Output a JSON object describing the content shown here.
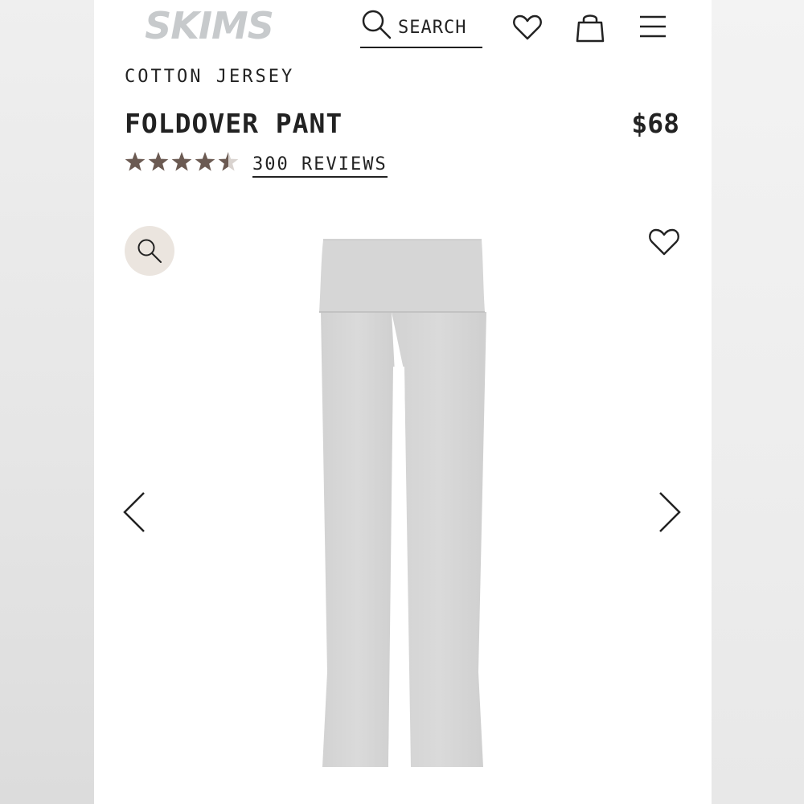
{
  "header": {
    "logo_text": "SKIMS",
    "search_label": "SEARCH",
    "icons": {
      "search": "search-icon",
      "wishlist": "heart-icon",
      "bag": "shopping-bag-icon",
      "menu": "hamburger-menu-icon"
    }
  },
  "product": {
    "category": "COTTON JERSEY",
    "title": "FOLDOVER PANT",
    "price": "$68",
    "rating": 4.5,
    "rating_max": 5,
    "reviews_label": "300 REVIEWS"
  },
  "gallery": {
    "icons": {
      "zoom": "magnifier-icon",
      "save": "heart-icon",
      "prev": "chevron-left-icon",
      "next": "chevron-right-icon"
    }
  },
  "colors": {
    "text": "#222222",
    "logo": "#c7cacc",
    "star": "#6b5a52",
    "zoom_bg": "#ebe5df",
    "product_gray": "#d4d4d4"
  }
}
